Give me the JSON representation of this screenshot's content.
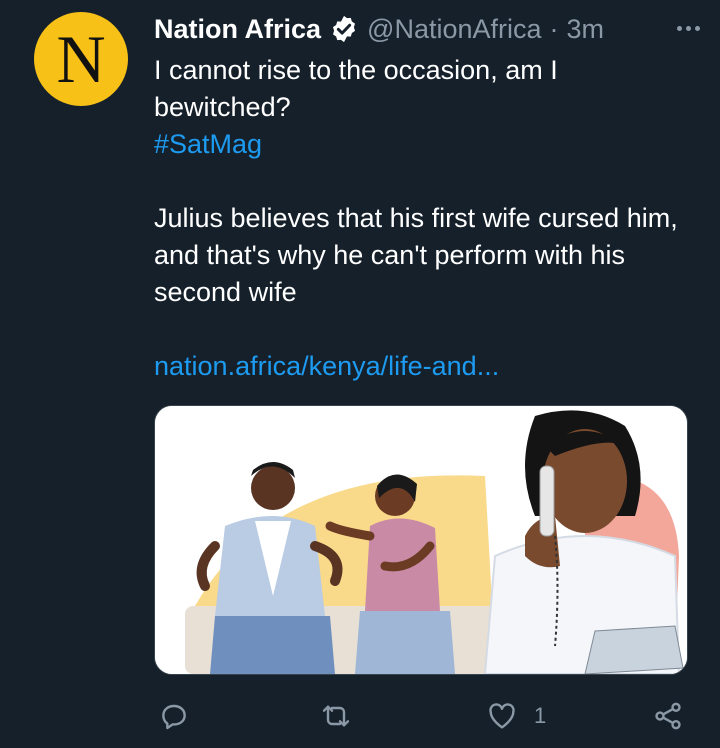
{
  "tweet": {
    "avatar_letter": "N",
    "author_name": "Nation Africa",
    "handle": "@NationAfrica",
    "separator": "·",
    "time": "3m",
    "text_lines": [
      "I cannot rise to the occasion, am I",
      "bewitched?"
    ],
    "hashtag": "#SatMag",
    "body_lines": [
      "Julius believes that his first wife cursed him,",
      "and that's why he can't perform with his",
      "second wife"
    ],
    "link": "nation.africa/kenya/life-and...",
    "like_count": "1"
  },
  "colors": {
    "background": "#15202b",
    "avatar": "#f8c118",
    "link": "#1d9bf0",
    "secondary_text": "#8b98a5"
  },
  "icons": [
    "verified-badge-icon",
    "more-icon",
    "reply-icon",
    "retweet-icon",
    "like-icon",
    "share-icon"
  ]
}
